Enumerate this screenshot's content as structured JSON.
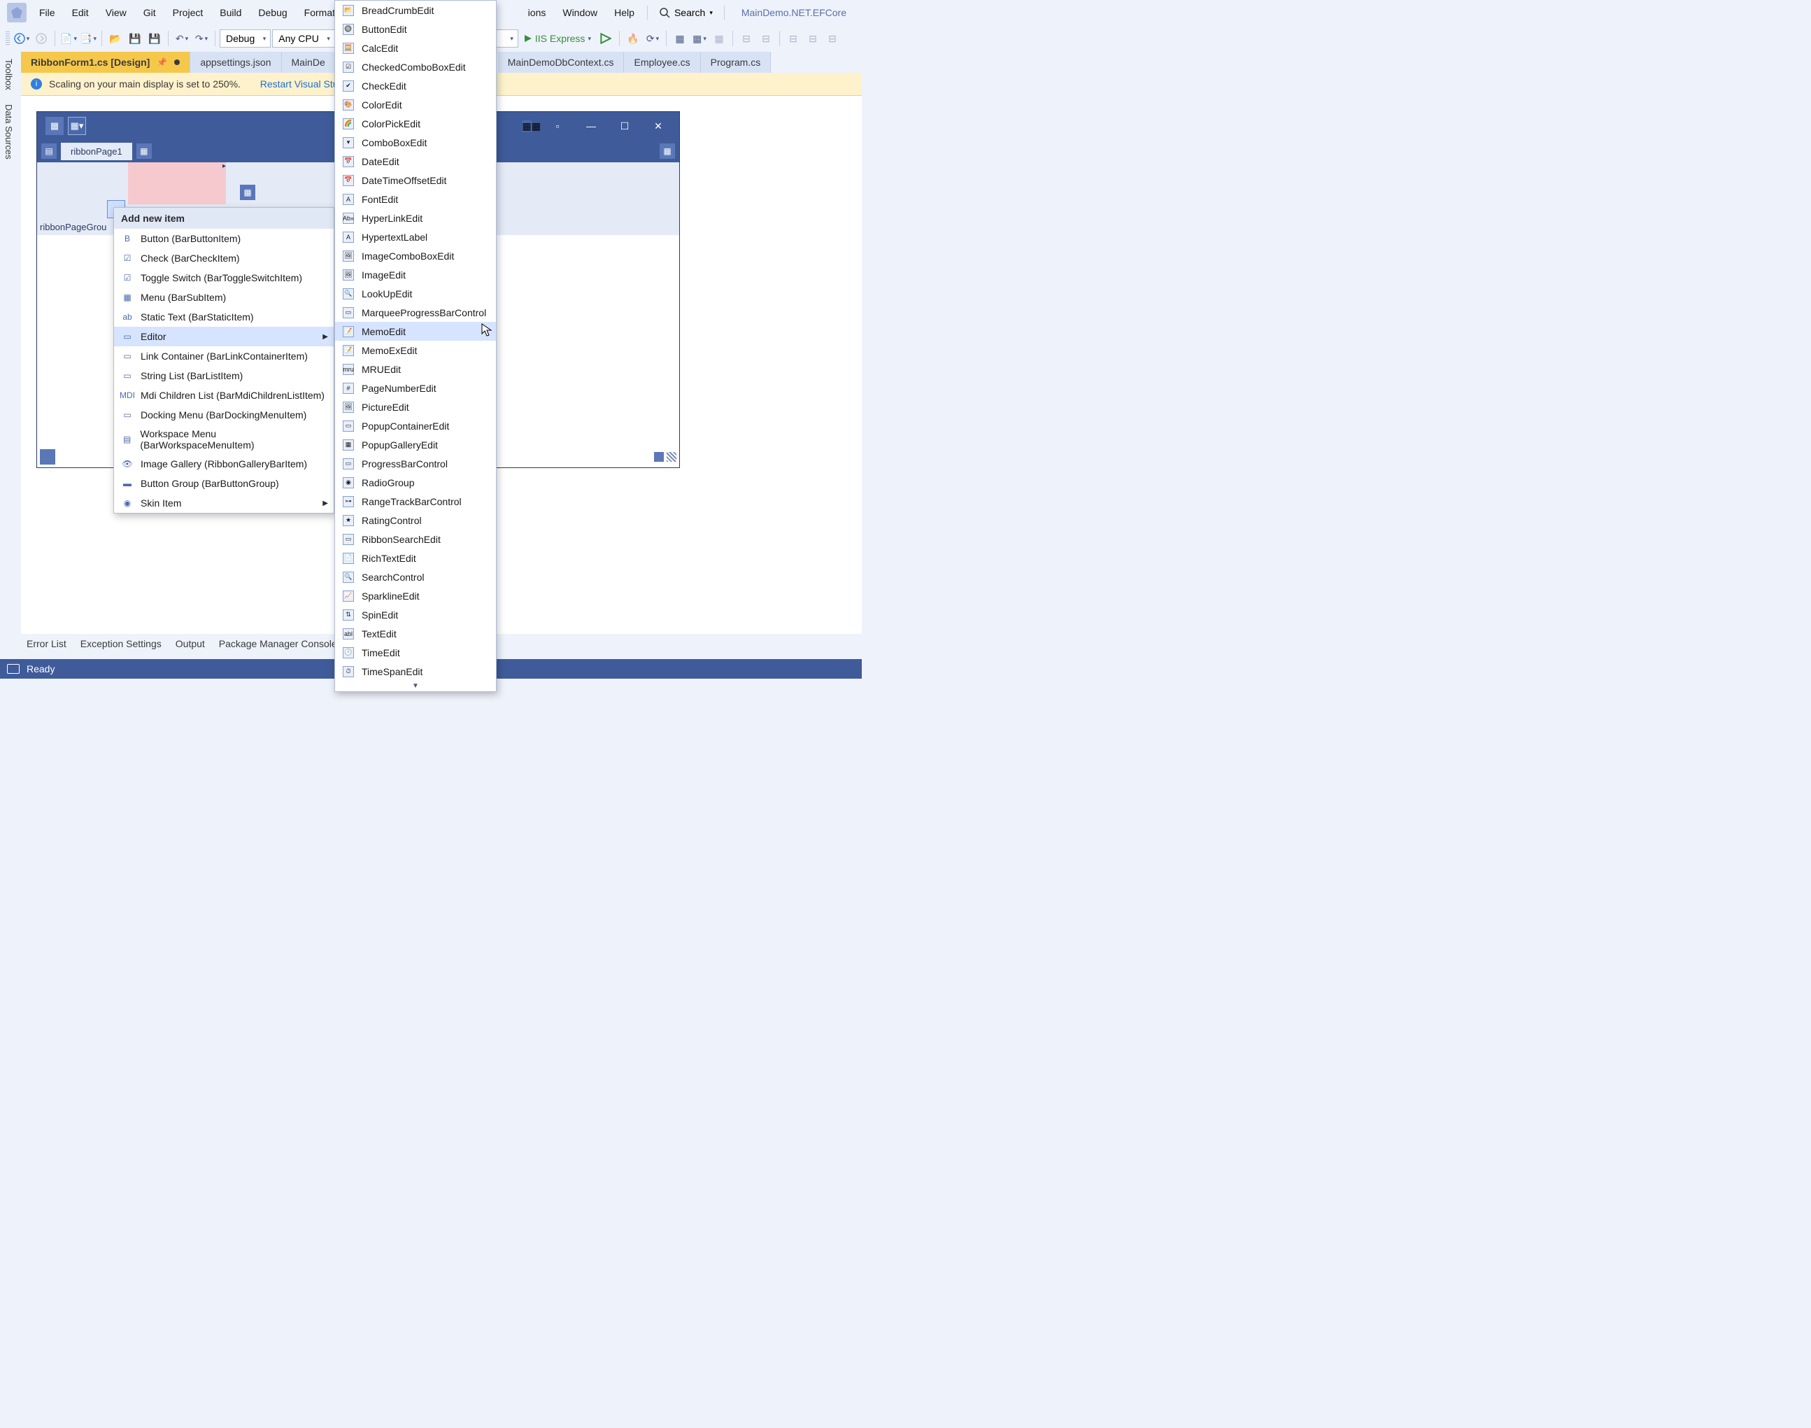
{
  "menubar": {
    "items": [
      "File",
      "Edit",
      "View",
      "Git",
      "Project",
      "Build",
      "Debug",
      "Format",
      "ions",
      "Window",
      "Help"
    ],
    "search_label": "Search",
    "app_name": "MainDemo.NET.EFCore"
  },
  "toolbar": {
    "config": "Debug",
    "platform": "Any CPU",
    "run_label": "IIS Express"
  },
  "leftrail": {
    "tabs": [
      "Toolbox",
      "Data Sources"
    ]
  },
  "doc_tabs": [
    {
      "label": "RibbonForm1.cs [Design]",
      "active": true,
      "dirty": true
    },
    {
      "label": "appsettings.json"
    },
    {
      "label": "MainDe"
    },
    {
      "label": "MainDemoDbContext.cs"
    },
    {
      "label": "Employee.cs"
    },
    {
      "label": "Program.cs"
    }
  ],
  "notice": {
    "text": "Scaling on your main display is set to 250%.",
    "link": "Restart Visual Studi"
  },
  "ribbon": {
    "page": "ribbonPage1",
    "group_label": "ribbonPageGrou"
  },
  "ctx1": {
    "title": "Add new item",
    "items": [
      {
        "label": "Button (BarButtonItem)",
        "ico": "B",
        "selected": false
      },
      {
        "label": "Check (BarCheckItem)",
        "ico": "☑"
      },
      {
        "label": "Toggle Switch (BarToggleSwitchItem)",
        "ico": "☑"
      },
      {
        "label": "Menu (BarSubItem)",
        "ico": "▦"
      },
      {
        "label": "Static Text (BarStaticItem)",
        "ico": "ab"
      },
      {
        "label": "Editor",
        "ico": "▭",
        "selected": true,
        "submenu": true
      },
      {
        "label": "Link Container (BarLinkContainerItem)",
        "ico": "▭"
      },
      {
        "label": "String List (BarListItem)",
        "ico": "▭"
      },
      {
        "label": "Mdi Children List (BarMdiChildrenListItem)",
        "ico": "MDI"
      },
      {
        "label": "Docking Menu (BarDockingMenuItem)",
        "ico": "▭"
      },
      {
        "label": "Workspace Menu (BarWorkspaceMenuItem)",
        "ico": "▤"
      },
      {
        "label": "Image Gallery (RibbonGalleryBarItem)",
        "ico": "👁"
      },
      {
        "label": "Button Group (BarButtonGroup)",
        "ico": "▬"
      },
      {
        "label": "Skin Item",
        "ico": "◉",
        "submenu": true
      }
    ]
  },
  "ctx2": {
    "items": [
      "BreadCrumbEdit",
      "ButtonEdit",
      "CalcEdit",
      "CheckedComboBoxEdit",
      "CheckEdit",
      "ColorEdit",
      "ColorPickEdit",
      "ComboBoxEdit",
      "DateEdit",
      "DateTimeOffsetEdit",
      "FontEdit",
      "HyperLinkEdit",
      "HypertextLabel",
      "ImageComboBoxEdit",
      "ImageEdit",
      "LookUpEdit",
      "MarqueeProgressBarControl",
      "MemoEdit",
      "MemoExEdit",
      "MRUEdit",
      "PageNumberEdit",
      "PictureEdit",
      "PopupContainerEdit",
      "PopupGalleryEdit",
      "ProgressBarControl",
      "RadioGroup",
      "RangeTrackBarControl",
      "RatingControl",
      "RibbonSearchEdit",
      "RichTextEdit",
      "SearchControl",
      "SparklineEdit",
      "SpinEdit",
      "TextEdit",
      "TimeEdit",
      "TimeSpanEdit"
    ],
    "selected": "MemoEdit"
  },
  "bottom_tools": [
    "Error List",
    "Exception Settings",
    "Output",
    "Package Manager Console"
  ],
  "status": {
    "text": "Ready"
  }
}
